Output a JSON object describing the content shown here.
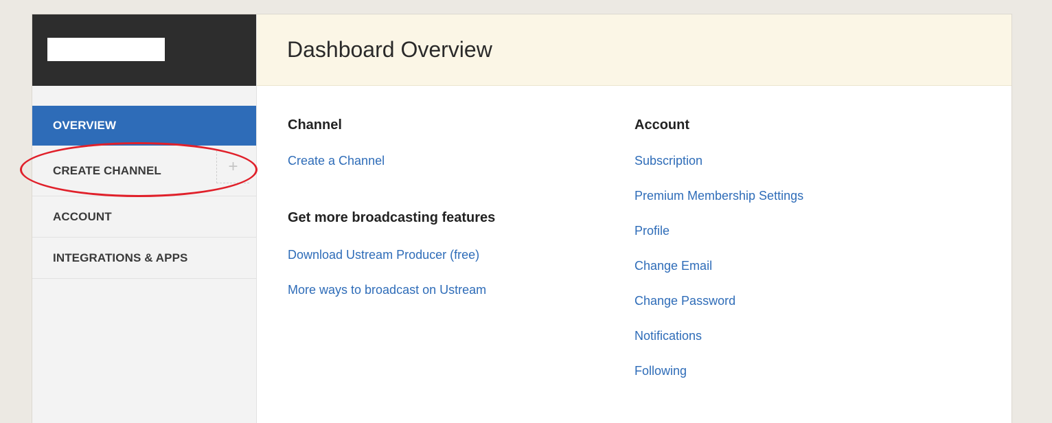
{
  "header": {
    "title": "Dashboard Overview"
  },
  "sidebar": {
    "items": [
      {
        "label": "OVERVIEW"
      },
      {
        "label": "CREATE CHANNEL",
        "action_glyph": "+"
      },
      {
        "label": "ACCOUNT"
      },
      {
        "label": "INTEGRATIONS & APPS"
      }
    ]
  },
  "channel": {
    "title": "Channel",
    "links": [
      "Create a Channel"
    ]
  },
  "broadcast": {
    "title": "Get more broadcasting features",
    "links": [
      "Download Ustream Producer (free)",
      "More ways to broadcast on Ustream"
    ]
  },
  "account": {
    "title": "Account",
    "links": [
      "Subscription",
      "Premium Membership Settings",
      "Profile",
      "Change Email",
      "Change Password",
      "Notifications",
      "Following"
    ]
  },
  "colors": {
    "accent": "#2e6cb8",
    "header_bg": "#fbf6e6",
    "logo_bar": "#2d2d2d",
    "highlight": "#e0202a"
  }
}
